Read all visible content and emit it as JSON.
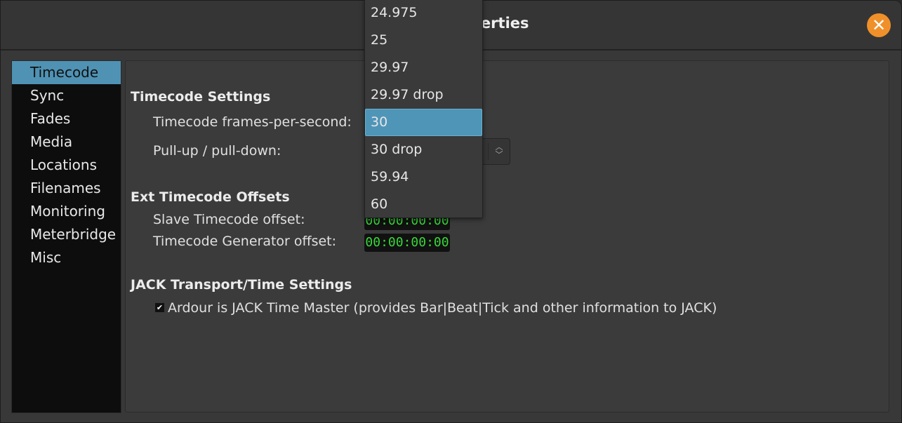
{
  "window": {
    "title": "Session Properties",
    "close_icon": "close-icon",
    "accent": "#f0902a"
  },
  "sidebar": {
    "selected": "Timecode",
    "items": [
      {
        "label": "Timecode"
      },
      {
        "label": "Sync"
      },
      {
        "label": "Fades"
      },
      {
        "label": "Media"
      },
      {
        "label": "Locations"
      },
      {
        "label": "Filenames"
      },
      {
        "label": "Monitoring"
      },
      {
        "label": "Meterbridge"
      },
      {
        "label": "Misc"
      }
    ]
  },
  "timecode": {
    "heading": "Timecode Settings",
    "fps_label": "Timecode frames-per-second:",
    "pull_label": "Pull-up / pull-down:",
    "fps_options": [
      "24.975",
      "25",
      "29.97",
      "29.97 drop",
      "30",
      "30 drop",
      "59.94",
      "60"
    ],
    "fps_selected": "30"
  },
  "offsets": {
    "heading": "Ext Timecode Offsets",
    "slave_label": "Slave Timecode offset:",
    "slave_value": "00:00:00:00",
    "generator_label": "Timecode Generator offset:",
    "generator_value": "00:00:00:00"
  },
  "jack": {
    "heading": "JACK Transport/Time Settings",
    "master_label": "Ardour is JACK Time Master (provides Bar|Beat|Tick and other information to JACK)",
    "master_checked": true
  },
  "colors": {
    "selection": "#4f95b8",
    "timecode_text": "#38d838"
  }
}
